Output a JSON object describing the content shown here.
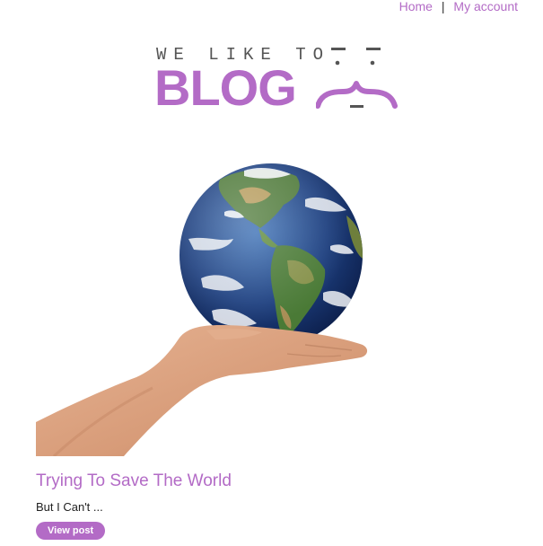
{
  "nav": {
    "home": "Home",
    "separator": "|",
    "account": "My account"
  },
  "logo": {
    "tagline": "WE LIKE TO",
    "word": "BLOG"
  },
  "hero": {
    "icon": "globe-in-hand-image"
  },
  "post": {
    "title": "Trying To Save The World",
    "excerpt": "But I Can't ...",
    "button": "View post"
  },
  "colors": {
    "accent": "#b36bc6",
    "text": "#222222",
    "background": "#ffffff"
  }
}
